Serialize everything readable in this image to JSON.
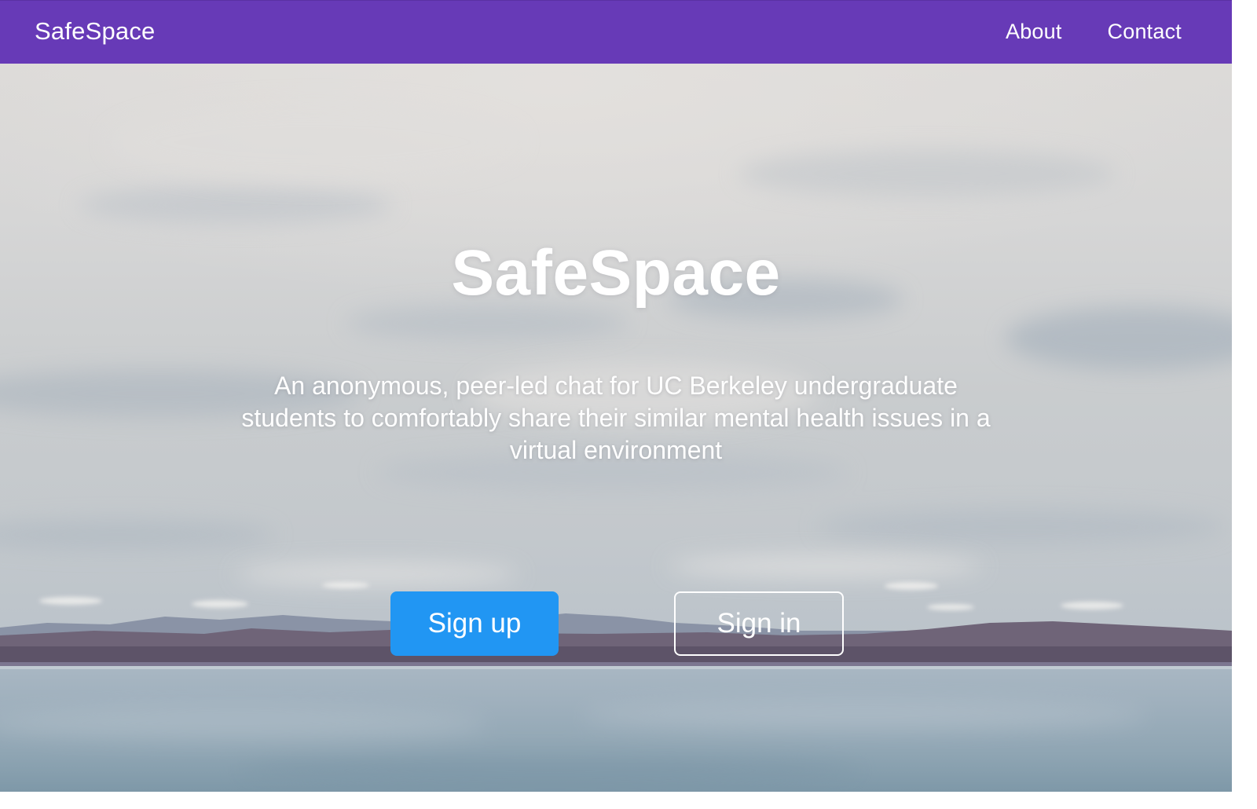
{
  "navbar": {
    "brand": "SafeSpace",
    "links": [
      {
        "label": "About"
      },
      {
        "label": "Contact"
      }
    ],
    "background_color": "#673ab7"
  },
  "hero": {
    "title": "SafeSpace",
    "subtitle": "An anonymous, peer-led chat for UC Berkeley undergraduate students to comfortably share their similar mental health issues in a virtual environment",
    "buttons": {
      "signup_label": "Sign up",
      "signin_label": "Sign in"
    },
    "accent_color": "#2196f3"
  }
}
